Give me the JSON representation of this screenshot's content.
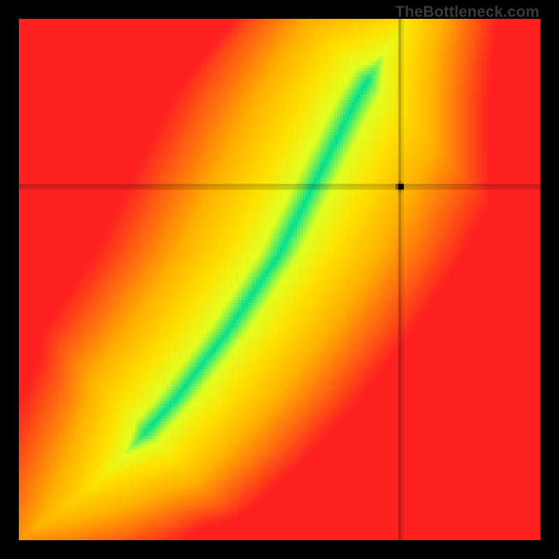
{
  "watermark": "TheBottleneck.com",
  "chart_data": {
    "type": "heatmap",
    "title": "",
    "xlabel": "",
    "ylabel": "",
    "xlim": [
      0,
      1
    ],
    "ylim": [
      0,
      1
    ],
    "grid": false,
    "legend": false,
    "description": "Bottleneck compatibility heatmap. Color encodes fit quality from green (ideal) through yellow/orange to red (poor). The green optimal band follows a superlinear curve from lower-left to upper-right. Crosshair marks the selected configuration point.",
    "crosshair": {
      "x": 0.732,
      "y": 0.678
    },
    "optimal_curve": [
      {
        "x": 0.0,
        "y": 0.0
      },
      {
        "x": 0.1,
        "y": 0.07
      },
      {
        "x": 0.2,
        "y": 0.16
      },
      {
        "x": 0.3,
        "y": 0.27
      },
      {
        "x": 0.4,
        "y": 0.4
      },
      {
        "x": 0.5,
        "y": 0.55
      },
      {
        "x": 0.55,
        "y": 0.65
      },
      {
        "x": 0.6,
        "y": 0.75
      },
      {
        "x": 0.65,
        "y": 0.85
      },
      {
        "x": 0.7,
        "y": 0.93
      },
      {
        "x": 0.75,
        "y": 1.0
      }
    ],
    "color_scale": [
      {
        "value": 0.0,
        "color": "#ff2020"
      },
      {
        "value": 0.45,
        "color": "#ffb000"
      },
      {
        "value": 0.7,
        "color": "#ffe000"
      },
      {
        "value": 0.88,
        "color": "#e0ff20"
      },
      {
        "value": 1.0,
        "color": "#00e090"
      }
    ],
    "band_half_width": 0.055
  }
}
